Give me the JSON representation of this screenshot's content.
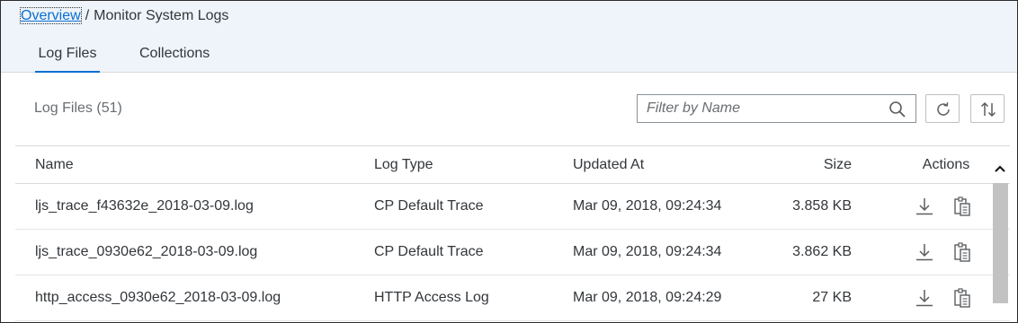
{
  "breadcrumb": {
    "link": "Overview",
    "separator": "/",
    "current": "Monitor System Logs"
  },
  "tabs": [
    {
      "label": "Log Files"
    },
    {
      "label": "Collections"
    }
  ],
  "toolbar": {
    "title": "Log Files (51)",
    "filter_placeholder": "Filter by Name"
  },
  "table": {
    "headers": {
      "name": "Name",
      "type": "Log Type",
      "updated": "Updated At",
      "size": "Size",
      "actions": "Actions"
    },
    "rows": [
      {
        "name": "ljs_trace_f43632e_2018-03-09.log",
        "type": "CP Default Trace",
        "updated": "Mar 09, 2018, 09:24:34",
        "size": "3.858 KB"
      },
      {
        "name": "ljs_trace_0930e62_2018-03-09.log",
        "type": "CP Default Trace",
        "updated": "Mar 09, 2018, 09:24:34",
        "size": "3.862 KB"
      },
      {
        "name": "http_access_0930e62_2018-03-09.log",
        "type": "HTTP Access Log",
        "updated": "Mar 09, 2018, 09:24:29",
        "size": "27 KB"
      }
    ]
  },
  "icons": {
    "search": "search-icon",
    "refresh": "refresh-icon",
    "sort": "sort-icon",
    "download": "download-icon",
    "copy": "copy-icon",
    "scroll_up": "chevron-up-icon"
  },
  "colors": {
    "accent": "#0a6ed1",
    "header_bg": "#eef4f9",
    "text": "#32363a",
    "muted_text": "#6a6d70"
  }
}
